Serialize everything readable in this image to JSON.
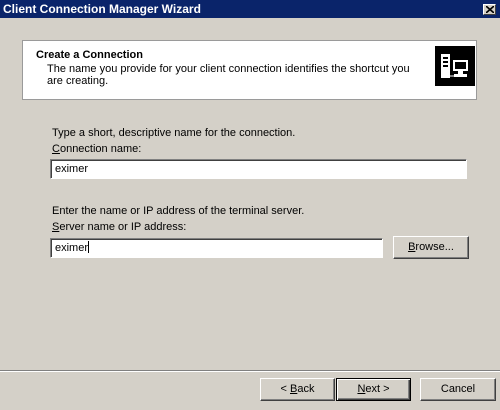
{
  "window": {
    "title": "Client Connection Manager Wizard"
  },
  "header": {
    "title": "Create a Connection",
    "description": "The name you provide for your client connection identifies the shortcut you are creating."
  },
  "connection": {
    "instruction": "Type a short, descriptive name for the connection.",
    "label_first": "C",
    "label_rest": "onnection name:",
    "value": "eximer"
  },
  "server": {
    "instruction": "Enter the name or IP address of the terminal server.",
    "label_first": "S",
    "label_rest": "erver name or IP address:",
    "value": "eximer"
  },
  "buttons": {
    "browse_first": "B",
    "browse_rest": "rowse...",
    "back_prefix": "< ",
    "back_first": "B",
    "back_rest": "ack",
    "next_first": "N",
    "next_rest": "ext >",
    "cancel": "Cancel"
  },
  "icons": {
    "wizard": "terminal-server-icon",
    "close": "close-icon"
  },
  "colors": {
    "titlebar": "#0a246a",
    "face": "#d4d0c8"
  }
}
